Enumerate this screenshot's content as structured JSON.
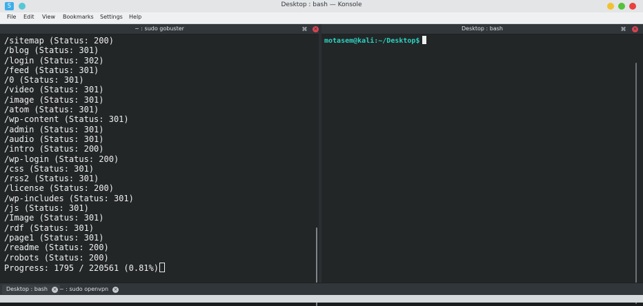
{
  "window": {
    "title": "Desktop : bash — Konsole",
    "app_icon": "konsole-icon",
    "app_icon_glyph": "S"
  },
  "menubar": {
    "items": [
      "File",
      "Edit",
      "View",
      "Bookmarks",
      "Settings",
      "Help"
    ]
  },
  "left_pane": {
    "title": "~ : sudo gobuster",
    "lines": [
      "/sitemap (Status: 200)",
      "/blog (Status: 301)",
      "/login (Status: 302)",
      "/feed (Status: 301)",
      "/0 (Status: 301)",
      "/video (Status: 301)",
      "/image (Status: 301)",
      "/atom (Status: 301)",
      "/wp-content (Status: 301)",
      "/admin (Status: 301)",
      "/audio (Status: 301)",
      "/intro (Status: 200)",
      "/wp-login (Status: 200)",
      "/css (Status: 301)",
      "/rss2 (Status: 301)",
      "/license (Status: 200)",
      "/wp-includes (Status: 301)",
      "/js (Status: 301)",
      "/Image (Status: 301)",
      "/rdf (Status: 301)",
      "/page1 (Status: 301)",
      "/readme (Status: 200)",
      "/robots (Status: 200)"
    ],
    "progress_line": "Progress: 1795 / 220561 (0.81%)"
  },
  "right_pane": {
    "title": "Desktop : bash",
    "prompt": "motasem@kali:~/Desktop$"
  },
  "tabs": [
    {
      "label": "Desktop : bash",
      "active": true
    },
    {
      "label": "~ : sudo openvpn",
      "active": false
    }
  ],
  "colors": {
    "prompt": "#2bd4c2",
    "terminal_bg": "#232627",
    "terminal_fg": "#eff0f1"
  }
}
